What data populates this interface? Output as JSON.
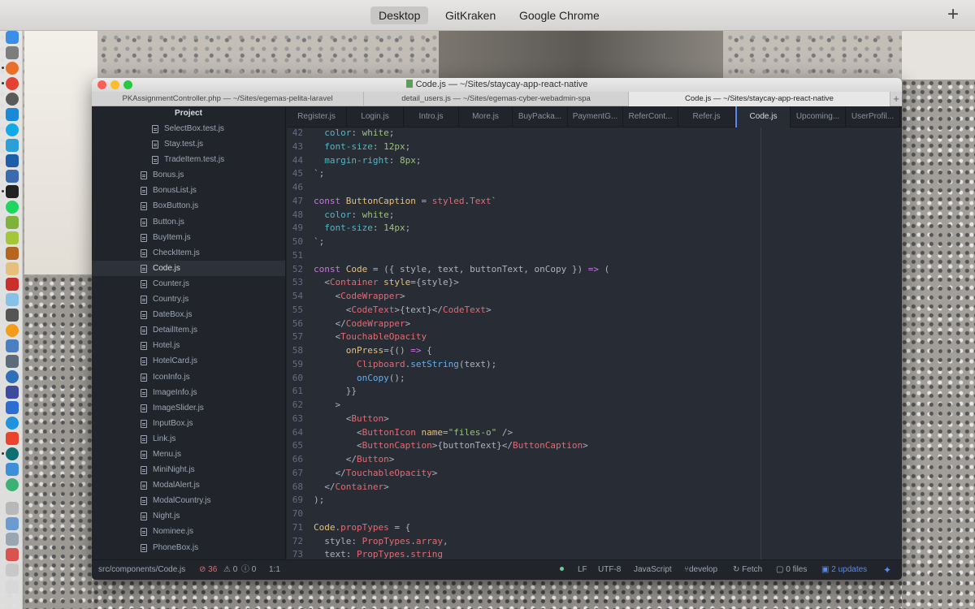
{
  "topbar": {
    "spaces": [
      "Desktop",
      "GitKraken",
      "Google Chrome"
    ],
    "active_space": "Desktop",
    "add_label": "+"
  },
  "window": {
    "title": "Code.js — ~/Sites/staycay-app-react-native",
    "window_tabs": [
      "PKAssignmentController.php — ~/Sites/egemas-pelita-laravel",
      "detail_users.js — ~/Sites/egemas-cyber-webadmin-spa",
      "Code.js — ~/Sites/staycay-app-react-native"
    ],
    "window_tab_plus": "+"
  },
  "sidebar": {
    "title": "Project",
    "files": [
      {
        "name": "SelectBox.test.js",
        "indent": 2
      },
      {
        "name": "Stay.test.js",
        "indent": 2
      },
      {
        "name": "TradeItem.test.js",
        "indent": 2
      },
      {
        "name": "Bonus.js",
        "indent": 1
      },
      {
        "name": "BonusList.js",
        "indent": 1
      },
      {
        "name": "BoxButton.js",
        "indent": 1
      },
      {
        "name": "Button.js",
        "indent": 1
      },
      {
        "name": "BuyItem.js",
        "indent": 1
      },
      {
        "name": "CheckItem.js",
        "indent": 1
      },
      {
        "name": "Code.js",
        "indent": 1,
        "selected": true
      },
      {
        "name": "Counter.js",
        "indent": 1
      },
      {
        "name": "Country.js",
        "indent": 1
      },
      {
        "name": "DateBox.js",
        "indent": 1
      },
      {
        "name": "DetailItem.js",
        "indent": 1
      },
      {
        "name": "Hotel.js",
        "indent": 1
      },
      {
        "name": "HotelCard.js",
        "indent": 1
      },
      {
        "name": "IconInfo.js",
        "indent": 1
      },
      {
        "name": "ImageInfo.js",
        "indent": 1
      },
      {
        "name": "ImageSlider.js",
        "indent": 1
      },
      {
        "name": "InputBox.js",
        "indent": 1
      },
      {
        "name": "Link.js",
        "indent": 1
      },
      {
        "name": "Menu.js",
        "indent": 1
      },
      {
        "name": "MiniNight.js",
        "indent": 1
      },
      {
        "name": "ModalAlert.js",
        "indent": 1
      },
      {
        "name": "ModalCountry.js",
        "indent": 1
      },
      {
        "name": "Night.js",
        "indent": 1
      },
      {
        "name": "Nominee.js",
        "indent": 1
      },
      {
        "name": "PhoneBox.js",
        "indent": 1
      }
    ]
  },
  "editor": {
    "tabs": [
      {
        "label": "Register.js"
      },
      {
        "label": "Login.js"
      },
      {
        "label": "Intro.js"
      },
      {
        "label": "More.js"
      },
      {
        "label": "BuyPacka..."
      },
      {
        "label": "PaymentG..."
      },
      {
        "label": "ReferCont..."
      },
      {
        "label": "Refer.js"
      },
      {
        "label": "Code.js",
        "active": true
      },
      {
        "label": "Upcoming..."
      },
      {
        "label": "UserProfil..."
      }
    ],
    "lines": [
      {
        "n": "42",
        "tokens": [
          [
            "",
            "  "
          ],
          [
            "c",
            "color"
          ],
          [
            "",
            ": "
          ],
          [
            "s",
            "white"
          ],
          [
            "",
            ";"
          ]
        ]
      },
      {
        "n": "43",
        "tokens": [
          [
            "",
            "  "
          ],
          [
            "c",
            "font-size"
          ],
          [
            "",
            ": "
          ],
          [
            "s",
            "12px"
          ],
          [
            "",
            ";"
          ]
        ]
      },
      {
        "n": "44",
        "tokens": [
          [
            "",
            "  "
          ],
          [
            "c",
            "margin-right"
          ],
          [
            "",
            ": "
          ],
          [
            "s",
            "8px"
          ],
          [
            "",
            ";"
          ]
        ]
      },
      {
        "n": "45",
        "tokens": [
          [
            "s",
            "`"
          ],
          [
            "",
            ";"
          ]
        ]
      },
      {
        "n": "46",
        "tokens": []
      },
      {
        "n": "47",
        "tokens": [
          [
            "k",
            "const"
          ],
          [
            "",
            " "
          ],
          [
            "f",
            "ButtonCaption"
          ],
          [
            "",
            " = "
          ],
          [
            "p",
            "styled"
          ],
          [
            "",
            "."
          ],
          [
            "p",
            "Text"
          ],
          [
            "s",
            "`"
          ]
        ]
      },
      {
        "n": "48",
        "tokens": [
          [
            "",
            "  "
          ],
          [
            "c",
            "color"
          ],
          [
            "",
            ": "
          ],
          [
            "s",
            "white"
          ],
          [
            "",
            ";"
          ]
        ]
      },
      {
        "n": "49",
        "tokens": [
          [
            "",
            "  "
          ],
          [
            "c",
            "font-size"
          ],
          [
            "",
            ": "
          ],
          [
            "s",
            "14px"
          ],
          [
            "",
            ";"
          ]
        ]
      },
      {
        "n": "50",
        "tokens": [
          [
            "s",
            "`"
          ],
          [
            "",
            ";"
          ]
        ]
      },
      {
        "n": "51",
        "tokens": []
      },
      {
        "n": "52",
        "tokens": [
          [
            "k",
            "const"
          ],
          [
            "",
            " "
          ],
          [
            "f",
            "Code"
          ],
          [
            "",
            " = ({ style, text, buttonText, onCopy }) "
          ],
          [
            "k",
            "=>"
          ],
          [
            "",
            " ("
          ]
        ]
      },
      {
        "n": "53",
        "tokens": [
          [
            "",
            "  "
          ],
          [
            "",
            "<"
          ],
          [
            "t",
            "Container"
          ],
          [
            "",
            " "
          ],
          [
            "f",
            "style"
          ],
          [
            "",
            "={style}>"
          ]
        ]
      },
      {
        "n": "54",
        "tokens": [
          [
            "",
            "    <"
          ],
          [
            "t",
            "CodeWrapper"
          ],
          [
            "",
            ">"
          ]
        ]
      },
      {
        "n": "55",
        "tokens": [
          [
            "",
            "      <"
          ],
          [
            "t",
            "CodeText"
          ],
          [
            "",
            ">{text}</"
          ],
          [
            "t",
            "CodeText"
          ],
          [
            "",
            ">"
          ]
        ]
      },
      {
        "n": "56",
        "tokens": [
          [
            "",
            "    </"
          ],
          [
            "t",
            "CodeWrapper"
          ],
          [
            "",
            ">"
          ]
        ]
      },
      {
        "n": "57",
        "tokens": [
          [
            "",
            "    <"
          ],
          [
            "t",
            "TouchableOpacity"
          ]
        ]
      },
      {
        "n": "58",
        "tokens": [
          [
            "",
            "      "
          ],
          [
            "f",
            "onPress"
          ],
          [
            "",
            "={() "
          ],
          [
            "k",
            "=>"
          ],
          [
            "",
            " {"
          ]
        ]
      },
      {
        "n": "59",
        "tokens": [
          [
            "",
            "        "
          ],
          [
            "p",
            "Clipboard"
          ],
          [
            "",
            "."
          ],
          [
            "fn",
            "setString"
          ],
          [
            "",
            "(text);"
          ]
        ]
      },
      {
        "n": "60",
        "tokens": [
          [
            "",
            "        "
          ],
          [
            "fn",
            "onCopy"
          ],
          [
            "",
            "();"
          ]
        ]
      },
      {
        "n": "61",
        "tokens": [
          [
            "",
            "      }}"
          ]
        ]
      },
      {
        "n": "62",
        "tokens": [
          [
            "",
            "    >"
          ]
        ]
      },
      {
        "n": "63",
        "tokens": [
          [
            "",
            "      <"
          ],
          [
            "t",
            "Button"
          ],
          [
            "",
            ">"
          ]
        ]
      },
      {
        "n": "64",
        "tokens": [
          [
            "",
            "        <"
          ],
          [
            "t",
            "ButtonIcon"
          ],
          [
            "",
            " "
          ],
          [
            "f",
            "name"
          ],
          [
            "",
            "="
          ],
          [
            "s",
            "\"files-o\""
          ],
          [
            "",
            " />"
          ]
        ]
      },
      {
        "n": "65",
        "tokens": [
          [
            "",
            "        <"
          ],
          [
            "t",
            "ButtonCaption"
          ],
          [
            "",
            ">{buttonText}</"
          ],
          [
            "t",
            "ButtonCaption"
          ],
          [
            "",
            ">"
          ]
        ]
      },
      {
        "n": "66",
        "tokens": [
          [
            "",
            "      </"
          ],
          [
            "t",
            "Button"
          ],
          [
            "",
            ">"
          ]
        ]
      },
      {
        "n": "67",
        "tokens": [
          [
            "",
            "    </"
          ],
          [
            "t",
            "TouchableOpacity"
          ],
          [
            "",
            ">"
          ]
        ]
      },
      {
        "n": "68",
        "tokens": [
          [
            "",
            "  </"
          ],
          [
            "t",
            "Container"
          ],
          [
            "",
            ">"
          ]
        ]
      },
      {
        "n": "69",
        "tokens": [
          [
            "",
            ");"
          ]
        ]
      },
      {
        "n": "70",
        "tokens": []
      },
      {
        "n": "71",
        "tokens": [
          [
            "f",
            "Code"
          ],
          [
            "",
            "."
          ],
          [
            "p",
            "propTypes"
          ],
          [
            "",
            " = {"
          ]
        ]
      },
      {
        "n": "72",
        "tokens": [
          [
            "",
            "  style: "
          ],
          [
            "p",
            "PropTypes"
          ],
          [
            "",
            "."
          ],
          [
            "p",
            "array"
          ],
          [
            "",
            ","
          ]
        ]
      },
      {
        "n": "73",
        "tokens": [
          [
            "",
            "  text: "
          ],
          [
            "p",
            "PropTypes"
          ],
          [
            "",
            "."
          ],
          [
            "p",
            "string"
          ]
        ]
      }
    ]
  },
  "statusbar": {
    "path": "src/components/Code.js",
    "errors": "36",
    "warnings": "0",
    "infos": "0",
    "cursor": "1:1",
    "line_ending": "LF",
    "encoding": "UTF-8",
    "grammar": "JavaScript",
    "branch": "develop",
    "fetch": "Fetch",
    "files": "0 files",
    "updates": "2 updates"
  },
  "colors": {
    "accent": "#568af2",
    "error": "#e06c75",
    "editor_bg": "#282c34",
    "sidebar_bg": "#21252b"
  }
}
